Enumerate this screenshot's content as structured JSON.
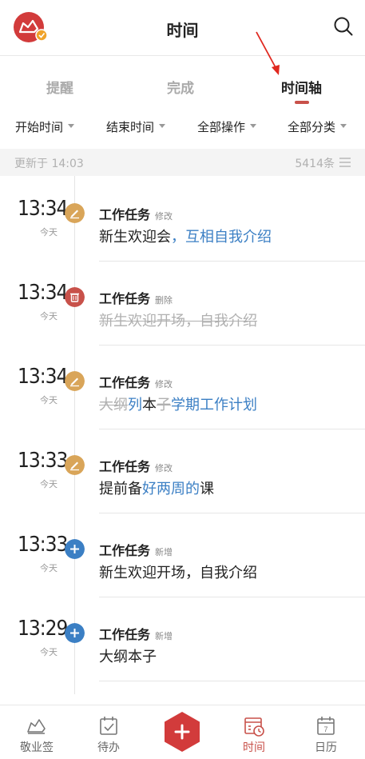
{
  "header": {
    "title": "时间"
  },
  "tabs": [
    {
      "label": "提醒",
      "active": false
    },
    {
      "label": "完成",
      "active": false
    },
    {
      "label": "时间轴",
      "active": true
    }
  ],
  "filters": [
    {
      "label": "开始时间"
    },
    {
      "label": "结束时间"
    },
    {
      "label": "全部操作"
    },
    {
      "label": "全部分类"
    }
  ],
  "status": {
    "updated": "更新于 14:03",
    "count": "5414条"
  },
  "colors": {
    "accent": "#c8514a",
    "edit": "#d9a559",
    "delete": "#c8514a",
    "add": "#3b7fc4",
    "link": "#3b7fc4"
  },
  "entries": [
    {
      "time": "13:34",
      "date": "今天",
      "icon": "pencil-icon",
      "title": "工作任务",
      "op": "修改",
      "desc": [
        {
          "text": "新生欢迎会",
          "style": "normal"
        },
        {
          "text": "，互相自我介绍",
          "style": "blue"
        }
      ]
    },
    {
      "time": "13:34",
      "date": "今天",
      "icon": "trash-icon",
      "title": "工作任务",
      "op": "删除",
      "desc": [
        {
          "text": "新生欢迎开场，自我介绍",
          "style": "deleted"
        }
      ]
    },
    {
      "time": "13:34",
      "date": "今天",
      "icon": "pencil-icon",
      "title": "工作任务",
      "op": "修改",
      "desc": [
        {
          "text": "大纲",
          "style": "deleted"
        },
        {
          "text": "列",
          "style": "blue"
        },
        {
          "text": "本",
          "style": "normal"
        },
        {
          "text": "子",
          "style": "deleted"
        },
        {
          "text": "学期工作计划",
          "style": "blue"
        }
      ]
    },
    {
      "time": "13:33",
      "date": "今天",
      "icon": "pencil-icon",
      "title": "工作任务",
      "op": "修改",
      "desc": [
        {
          "text": "提前备",
          "style": "normal"
        },
        {
          "text": "好两周的",
          "style": "blue"
        },
        {
          "text": "课",
          "style": "normal"
        }
      ]
    },
    {
      "time": "13:33",
      "date": "今天",
      "icon": "plus-icon",
      "title": "工作任务",
      "op": "新增",
      "desc": [
        {
          "text": "新生欢迎开场，自我介绍",
          "style": "normal"
        }
      ]
    },
    {
      "time": "13:29",
      "date": "今天",
      "icon": "plus-icon",
      "title": "工作任务",
      "op": "新增",
      "desc": [
        {
          "text": "大纲本子",
          "style": "normal"
        }
      ]
    }
  ],
  "nav": [
    {
      "label": "敬业签",
      "icon": "memo-icon",
      "active": false
    },
    {
      "label": "待办",
      "icon": "todo-icon",
      "active": false
    },
    {
      "label": "时间",
      "icon": "time-icon",
      "active": true
    },
    {
      "label": "日历",
      "icon": "calendar-icon",
      "active": false
    }
  ],
  "calendar_day": "7"
}
